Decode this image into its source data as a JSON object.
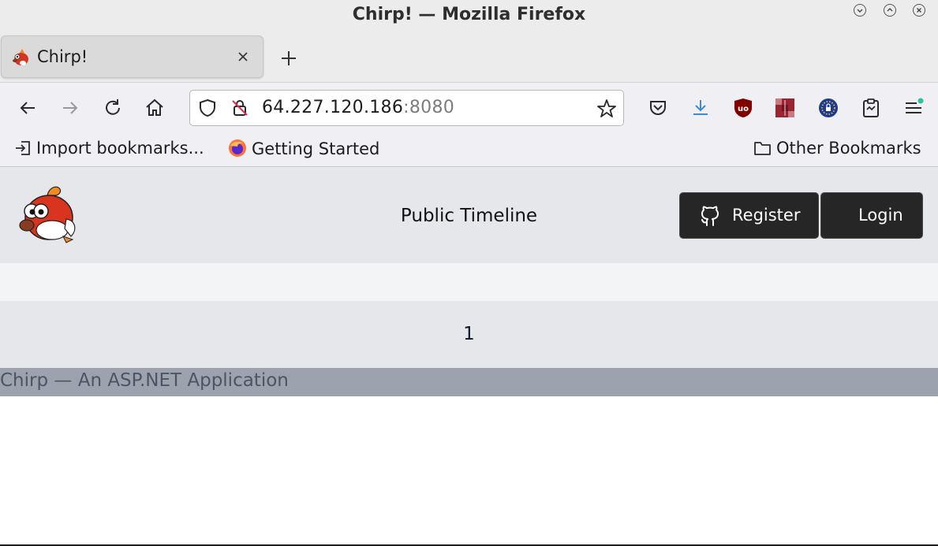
{
  "window": {
    "title": "Chirp! — Mozilla Firefox"
  },
  "tab": {
    "title": "Chirp!"
  },
  "urlbar": {
    "host": "64.227.120.186",
    "port": ":8080"
  },
  "bookmarks": {
    "import_label": "Import bookmarks...",
    "getting_started_label": "Getting Started",
    "other_label": "Other Bookmarks"
  },
  "toolbar_icons": [
    "back-icon",
    "forward-icon",
    "reload-icon",
    "home-icon",
    "pocket-icon",
    "downloads-icon",
    "ublock-icon",
    "extension-icon",
    "extension-icon",
    "clipboard-icon",
    "menu-icon"
  ],
  "header": {
    "page_title": "Public Timeline",
    "register_label": "Register",
    "login_label": "Login"
  },
  "pagination": {
    "current": "1"
  },
  "footer": {
    "text": "Chirp — An ASP.NET Application"
  },
  "colors": {
    "header_bg": "#e5e7eb",
    "button_bg": "#262626",
    "footer_bg": "#9ca3af",
    "strip_bg": "#f3f4f6"
  }
}
